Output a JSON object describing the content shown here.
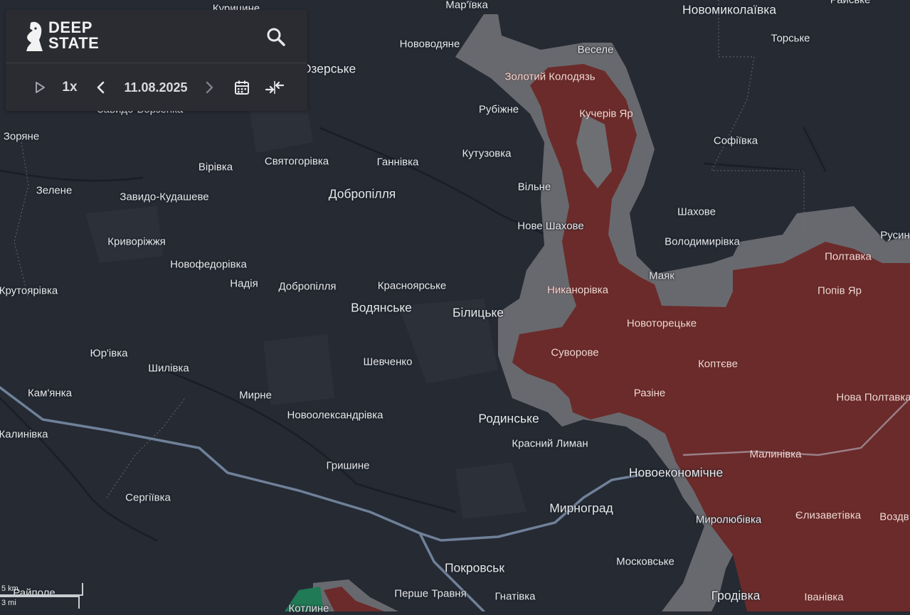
{
  "app": {
    "logo_line1": "DEEP",
    "logo_line2": "STATE"
  },
  "toolbar": {
    "play_icon": "play-icon",
    "speed_label": "1x",
    "prev_icon": "chevron-left-icon",
    "date": "11.08.2025",
    "next_icon": "chevron-right-icon",
    "calendar_icon": "calendar-icon",
    "collapse_icon": "collapse-arrows-icon",
    "search_icon": "search-icon"
  },
  "scale": {
    "km": "5 km",
    "mi": "3 mi"
  },
  "colors": {
    "background": "#252a33",
    "occupied": "#6b2b2a",
    "grey_zone": "#6e6f73",
    "highway": "#6f8199",
    "panel": "#2a2c31"
  },
  "places": [
    {
      "name": "Курицине",
      "lon": 332,
      "lat": 12,
      "size": "normal"
    },
    {
      "name": "Мар'ївка",
      "lon": 656,
      "lat": 7,
      "size": "normal"
    },
    {
      "name": "Новомиколаївка",
      "lon": 1025,
      "lat": 14,
      "size": "big"
    },
    {
      "name": "Райське",
      "lon": 1195,
      "lat": 0,
      "size": "normal"
    },
    {
      "name": "Торське",
      "lon": 1111,
      "lat": 54,
      "size": "normal"
    },
    {
      "name": "Нововодяне",
      "lon": 604,
      "lat": 62,
      "size": "normal"
    },
    {
      "name": "Веселе",
      "lon": 837,
      "lat": 70,
      "size": "normal"
    },
    {
      "name": "Золотий Колодязь",
      "lon": 773,
      "lat": 108,
      "size": "normal"
    },
    {
      "name": "Озерське",
      "lon": 462,
      "lat": 97,
      "size": "big"
    },
    {
      "name": "Кучерів Яр",
      "lon": 852,
      "lat": 160,
      "size": "normal"
    },
    {
      "name": "Рубіжне",
      "lon": 701,
      "lat": 154,
      "size": "normal"
    },
    {
      "name": "Завидо-Борзенка",
      "lon": 197,
      "lat": 154,
      "size": "normal"
    },
    {
      "name": "Зоряне",
      "lon": 30,
      "lat": 192,
      "size": "normal"
    },
    {
      "name": "Софіївка",
      "lon": 1034,
      "lat": 198,
      "size": "normal"
    },
    {
      "name": "Кутузовка",
      "lon": 684,
      "lat": 216,
      "size": "normal"
    },
    {
      "name": "Святогорівка",
      "lon": 417,
      "lat": 227,
      "size": "normal"
    },
    {
      "name": "Ганнівка",
      "lon": 559,
      "lat": 228,
      "size": "normal"
    },
    {
      "name": "Вірівка",
      "lon": 303,
      "lat": 235,
      "size": "normal"
    },
    {
      "name": "Вільне",
      "lon": 751,
      "lat": 263,
      "size": "normal"
    },
    {
      "name": "Зелене",
      "lon": 76,
      "lat": 268,
      "size": "normal"
    },
    {
      "name": "Добропілля",
      "lon": 509,
      "lat": 273,
      "size": "big"
    },
    {
      "name": "Завидо-Кудашеве",
      "lon": 231,
      "lat": 277,
      "size": "normal"
    },
    {
      "name": "Шахове",
      "lon": 979,
      "lat": 298,
      "size": "normal"
    },
    {
      "name": "Нове Шахове",
      "lon": 774,
      "lat": 318,
      "size": "normal"
    },
    {
      "name": "Русин",
      "lon": 1258,
      "lat": 331,
      "size": "normal"
    },
    {
      "name": "Криворіжжя",
      "lon": 192,
      "lat": 340,
      "size": "normal"
    },
    {
      "name": "Володимирівка",
      "lon": 987,
      "lat": 340,
      "size": "normal"
    },
    {
      "name": "Полтавка",
      "lon": 1192,
      "lat": 361,
      "size": "normal"
    },
    {
      "name": "Новофедорівка",
      "lon": 293,
      "lat": 372,
      "size": "normal"
    },
    {
      "name": "Маяк",
      "lon": 930,
      "lat": 388,
      "size": "normal"
    },
    {
      "name": "Надія",
      "lon": 343,
      "lat": 399,
      "size": "normal"
    },
    {
      "name": "Добропілля",
      "lon": 432,
      "lat": 403,
      "size": "normal"
    },
    {
      "name": "Красноярське",
      "lon": 579,
      "lat": 402,
      "size": "normal"
    },
    {
      "name": "Крутоярівка",
      "lon": 40,
      "lat": 409,
      "size": "normal"
    },
    {
      "name": "Никанорівка",
      "lon": 812,
      "lat": 408,
      "size": "normal"
    },
    {
      "name": "Попів Яр",
      "lon": 1180,
      "lat": 409,
      "size": "normal"
    },
    {
      "name": "Водянське",
      "lon": 536,
      "lat": 433,
      "size": "big"
    },
    {
      "name": "Білицьке",
      "lon": 672,
      "lat": 440,
      "size": "big"
    },
    {
      "name": "Новоторецьке",
      "lon": 930,
      "lat": 455,
      "size": "normal"
    },
    {
      "name": "Юр'івка",
      "lon": 153,
      "lat": 497,
      "size": "normal"
    },
    {
      "name": "Суворове",
      "lon": 808,
      "lat": 496,
      "size": "normal"
    },
    {
      "name": "Шевченко",
      "lon": 545,
      "lat": 509,
      "size": "normal"
    },
    {
      "name": "Коптєве",
      "lon": 1009,
      "lat": 512,
      "size": "normal"
    },
    {
      "name": "Шилівка",
      "lon": 237,
      "lat": 518,
      "size": "normal"
    },
    {
      "name": "Кам'янка",
      "lon": 70,
      "lat": 553,
      "size": "normal"
    },
    {
      "name": "Разіне",
      "lon": 913,
      "lat": 553,
      "size": "normal"
    },
    {
      "name": "Мирне",
      "lon": 359,
      "lat": 556,
      "size": "normal"
    },
    {
      "name": "Нова Полтавка",
      "lon": 1228,
      "lat": 559,
      "size": "normal"
    },
    {
      "name": "Новоолександрівка",
      "lon": 471,
      "lat": 584,
      "size": "normal"
    },
    {
      "name": "Родинське",
      "lon": 715,
      "lat": 589,
      "size": "big"
    },
    {
      "name": "Калинівка",
      "lon": 33,
      "lat": 611,
      "size": "normal"
    },
    {
      "name": "Красний Лиман",
      "lon": 773,
      "lat": 624,
      "size": "normal"
    },
    {
      "name": "Малинівка",
      "lon": 1090,
      "lat": 639,
      "size": "normal"
    },
    {
      "name": "Гришине",
      "lon": 489,
      "lat": 655,
      "size": "normal"
    },
    {
      "name": "Новоекономічне",
      "lon": 950,
      "lat": 665,
      "size": "big"
    },
    {
      "name": "Сергіївка",
      "lon": 208,
      "lat": 700,
      "size": "normal"
    },
    {
      "name": "Мирноград",
      "lon": 817,
      "lat": 715,
      "size": "big"
    },
    {
      "name": "Єлизаветівка",
      "lon": 1164,
      "lat": 725,
      "size": "normal"
    },
    {
      "name": "Миролюбівка",
      "lon": 1024,
      "lat": 731,
      "size": "normal"
    },
    {
      "name": "Воздв",
      "lon": 1257,
      "lat": 727,
      "size": "normal"
    },
    {
      "name": "Московське",
      "lon": 907,
      "lat": 790,
      "size": "normal"
    },
    {
      "name": "Покровськ",
      "lon": 667,
      "lat": 799,
      "size": "big"
    },
    {
      "name": "Райполе",
      "lon": 48,
      "lat": 834,
      "size": "normal"
    },
    {
      "name": "Перше Травня",
      "lon": 605,
      "lat": 835,
      "size": "normal"
    },
    {
      "name": "Гнатівка",
      "lon": 724,
      "lat": 839,
      "size": "normal"
    },
    {
      "name": "Гродівка",
      "lon": 1034,
      "lat": 838,
      "size": "big"
    },
    {
      "name": "Іванівка",
      "lon": 1158,
      "lat": 840,
      "size": "normal"
    },
    {
      "name": "Котлине",
      "lon": 434,
      "lat": 856,
      "size": "normal"
    }
  ],
  "pink_places": [
    "Золотий Колодязь",
    "Кучерів Яр",
    "Никанорівка",
    "Новоторецьке",
    "Суворове",
    "Коптєве",
    "Разіне",
    "Попів Яр",
    "Нова Полтавка",
    "Малинівка",
    "Єлизаветівка",
    "Іванівка",
    "Воздв",
    "Полтавка"
  ]
}
